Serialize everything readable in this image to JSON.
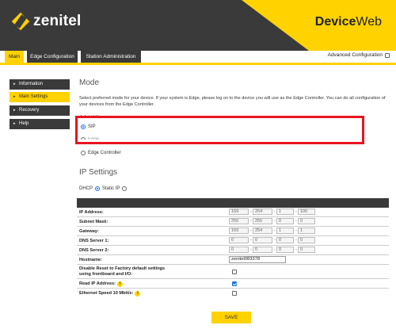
{
  "header": {
    "brand": "zenitel",
    "product_prefix": "Device",
    "product_suffix": "Web"
  },
  "tabs": [
    {
      "label": "Main",
      "active": true
    },
    {
      "label": "Edge Configuration",
      "active": false
    },
    {
      "label": "Station Administration",
      "active": false
    }
  ],
  "advanced_configuration": {
    "label": "Advanced Configuration",
    "checked": false
  },
  "sidebar": {
    "items": [
      {
        "label": "Information",
        "active": false
      },
      {
        "label": "Main Settings",
        "active": true
      },
      {
        "label": "Recovery",
        "active": false
      },
      {
        "label": "Help",
        "active": false
      }
    ]
  },
  "mode": {
    "title": "Mode",
    "description": "Select preferred mode for your device. If your system is Edge, please log on to the device you will use as the Edge Controller. You can do all configuration of your devices from the Edge Controller.",
    "options": [
      {
        "label": "Edge",
        "selected": false
      },
      {
        "label": "SIP",
        "selected": true
      },
      {
        "label": "Edge",
        "selected": false
      },
      {
        "label": "Edge Controller",
        "selected": false
      }
    ]
  },
  "ip_settings": {
    "title": "IP Settings",
    "dhcp_label": "DHCP",
    "dhcp_selected": true,
    "static_label": "Static IP",
    "static_selected": false,
    "ip_rows": [
      {
        "label": "IP Address:",
        "octets": [
          "169",
          "254",
          "1",
          "100"
        ]
      },
      {
        "label": "Subnet Mask:",
        "octets": [
          "255",
          "255",
          "0",
          "0"
        ]
      },
      {
        "label": "Gateway:",
        "octets": [
          "169",
          "254",
          "1",
          "1"
        ]
      },
      {
        "label": "DNS Server 1:",
        "octets": [
          "0",
          "0",
          "0",
          "0"
        ]
      },
      {
        "label": "DNS Server 2:",
        "octets": [
          "0",
          "0",
          "0",
          "0"
        ]
      }
    ],
    "hostname": {
      "label": "Hostname:",
      "value": "zenitel083378"
    },
    "disable_reset": {
      "label_line1": "Disable Reset to Factory default settings",
      "label_line2": "using frontboard and I/O:",
      "checked": false
    },
    "read_ip": {
      "label": "Read IP Address:",
      "checked": true,
      "info_icon": "info-icon"
    },
    "ethernet_speed": {
      "label": "Ethernet Speed 10 Mbit/s:",
      "checked": false,
      "info_icon": "info-icon"
    }
  },
  "save_label": "SAVE",
  "colors": {
    "brand_yellow": "#ffd200",
    "dark": "#3a3a3a",
    "highlight_red": "#e8151f",
    "check_blue": "#1a73e8"
  }
}
